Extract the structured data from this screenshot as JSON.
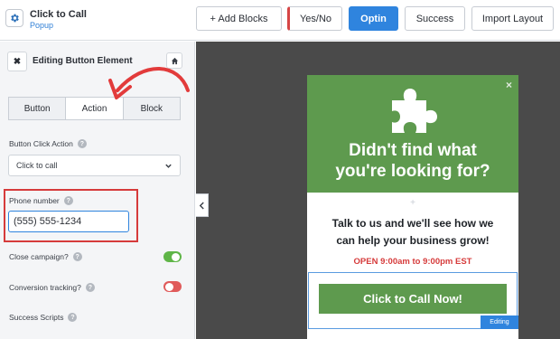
{
  "header": {
    "title": "Click to Call",
    "subtitle": "Popup",
    "buttons": {
      "add_blocks": "+ Add Blocks",
      "yes_no": "Yes/No",
      "optin": "Optin",
      "success": "Success",
      "import_layout": "Import Layout"
    },
    "active_view": "Optin"
  },
  "sidebar": {
    "panel_title": "Editing Button Element",
    "tabs": [
      "Button",
      "Action",
      "Block"
    ],
    "active_tab": "Action",
    "button_click_action": {
      "label": "Button Click Action",
      "value": "Click to call"
    },
    "phone_number": {
      "label": "Phone number",
      "value": "(555) 555-1234"
    },
    "close_campaign": {
      "label": "Close campaign?",
      "enabled": true
    },
    "conversion_tracking": {
      "label": "Conversion tracking?",
      "enabled": false
    },
    "success_scripts": {
      "label": "Success Scripts"
    },
    "help_glyph": "?"
  },
  "popup": {
    "headline_line1": "Didn't find what",
    "headline_line2": "you're looking for?",
    "divider_glyph": "+",
    "body_line1": "Talk to us and we'll see how we",
    "body_line2": "can help your business grow!",
    "hours": "OPEN 9:00am to 9:00pm EST",
    "cta": "Click to Call Now!",
    "editing_badge": "Editing",
    "close_glyph": "×"
  },
  "icons": {
    "settings": "gear-icon",
    "close_panel": "close-icon",
    "home": "home-icon",
    "dropdown": "chevron-down-icon",
    "collapse": "chevron-left-icon",
    "popup_graphic": "puzzle-piece-icon",
    "annotation": "curved-arrow-icon"
  },
  "colors": {
    "accent": "#2f84de",
    "popup_green": "#5e9a4e",
    "highlight_red": "#d63b3b",
    "toggle_on": "#5fb548",
    "toggle_off": "#e05b5b",
    "canvas": "#4a4a4a"
  }
}
